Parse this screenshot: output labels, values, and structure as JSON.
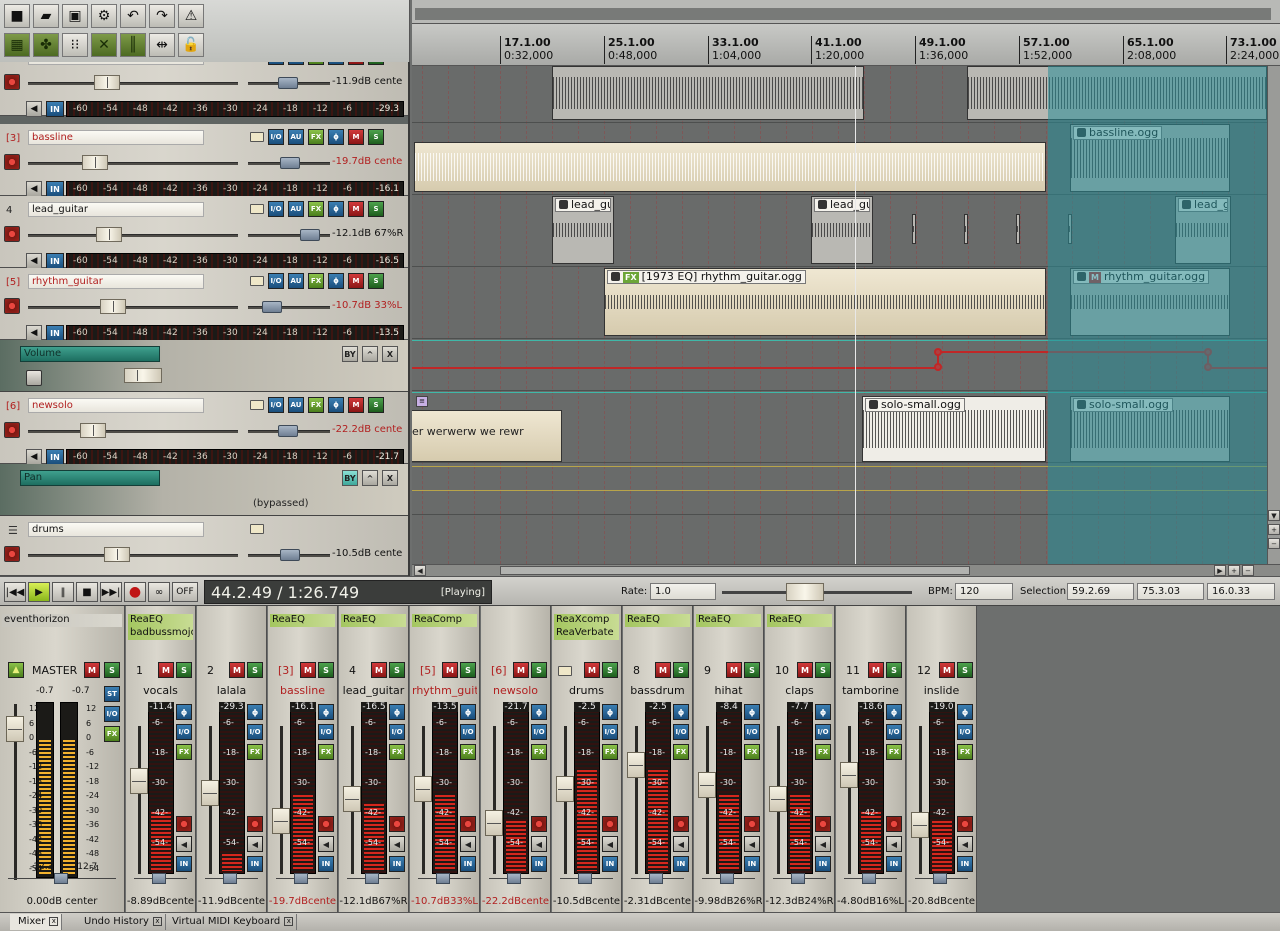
{
  "ruler": [
    {
      "bar": "17.1.00",
      "time": "0:32,000"
    },
    {
      "bar": "25.1.00",
      "time": "0:48,000"
    },
    {
      "bar": "33.1.00",
      "time": "1:04,000"
    },
    {
      "bar": "41.1.00",
      "time": "1:20,000"
    },
    {
      "bar": "49.1.00",
      "time": "1:36,000"
    },
    {
      "bar": "57.1.00",
      "time": "1:52,000"
    },
    {
      "bar": "65.1.00",
      "time": "2:08,000"
    },
    {
      "bar": "73.1.00",
      "time": "2:24,000"
    }
  ],
  "tracks": [
    {
      "num": "2",
      "name": "lalala",
      "vol": "-11.9dB cente",
      "peak": "-29.3",
      "highlight": false
    },
    {
      "num": "[3]",
      "name": "bassline",
      "vol": "-19.7dB cente",
      "peak": "-16.1",
      "highlight": true
    },
    {
      "num": "4",
      "name": "lead_guitar",
      "vol": "-12.1dB 67%R",
      "peak": "-16.5",
      "highlight": false
    },
    {
      "num": "[5]",
      "name": "rhythm_guitar",
      "vol": "-10.7dB 33%L",
      "peak": "-13.5",
      "highlight": true
    },
    {
      "num": "[6]",
      "name": "newsolo",
      "vol": "-22.2dB cente",
      "peak": "-21.7",
      "highlight": true
    },
    {
      "num": "",
      "name": "drums",
      "vol": "-10.5dB cente",
      "peak": "",
      "highlight": false
    }
  ],
  "track_buttons": {
    "phase": "ϕ",
    "mute": "M",
    "solo": "S",
    "au": "AU",
    "fx": "FX",
    "io": "I/O",
    "in": "IN"
  },
  "meter_scale": [
    "-60",
    "-54",
    "-48",
    "-42",
    "-36",
    "-30",
    "-24",
    "-18",
    "-12",
    "-6"
  ],
  "envelopes": {
    "volume": {
      "name": "Volume"
    },
    "pan": {
      "name": "Pan",
      "status": "(bypassed)"
    },
    "buttons": {
      "bypass": "BY",
      "arm": "^",
      "close": "X"
    }
  },
  "items": {
    "bassline": "bassline.ogg",
    "lead1": "lead_gu",
    "lead2": "lead_gu",
    "lead3": "lead_g",
    "rhythm1": "[1973 EQ] rhythm_guitar.ogg",
    "rhythm2": "rhythm_guitar.ogg",
    "solo1": "solo-small.ogg",
    "solo2": "solo-small.ogg",
    "text": "wer werwerw we rewr",
    "fx_tag": "FX",
    "m_tag": "M"
  },
  "transport": {
    "time": "44.2.49 / 1:26.749",
    "status": "[Playing]",
    "off": "OFF",
    "rate_label": "Rate:",
    "rate": "1.0",
    "bpm_label": "BPM:",
    "bpm": "120",
    "selection_label": "Selection",
    "sel_start": "59.2.69",
    "sel_end": "75.3.03",
    "sel_len": "16.0.33"
  },
  "master": {
    "theme_name": "eventhorizon",
    "label": "MASTER",
    "peak_l": "-0.7",
    "peak_r": "-0.7",
    "bottom_l": "-12.3",
    "bottom_r": "-12.7",
    "volume": "0.00dB center",
    "st": "ST",
    "scale": [
      "12",
      "6",
      "0",
      "-6",
      "-12",
      "-18",
      "-24",
      "-30",
      "-36",
      "-42",
      "-48",
      "-54"
    ]
  },
  "strips": [
    {
      "num": "1",
      "name": "vocals",
      "fx1": "ReaEQ",
      "fx2": "badbussmojo",
      "peak": "-11.4",
      "vol": "-8.89dBcente",
      "hl": false,
      "level": 0.35,
      "fader": 0.35
    },
    {
      "num": "2",
      "name": "lalala",
      "fx1": "",
      "fx2": "",
      "peak": "-29.3",
      "vol": "-11.9dBcente",
      "hl": false,
      "level": 0.1,
      "fader": 0.45
    },
    {
      "num": "[3]",
      "name": "bassline",
      "fx1": "ReaEQ",
      "fx2": "",
      "peak": "-16.1",
      "vol": "-19.7dBcente",
      "hl": true,
      "level": 0.45,
      "fader": 0.68
    },
    {
      "num": "4",
      "name": "lead_guitar",
      "fx1": "ReaEQ",
      "fx2": "",
      "peak": "-16.5",
      "vol": "-12.1dB67%R",
      "hl": false,
      "level": 0.4,
      "fader": 0.5
    },
    {
      "num": "[5]",
      "name": "rhythm_guit",
      "fx1": "ReaComp",
      "fx2": "",
      "peak": "-13.5",
      "vol": "-10.7dB33%L",
      "hl": true,
      "level": 0.45,
      "fader": 0.42
    },
    {
      "num": "[6]",
      "name": "newsolo",
      "fx1": "",
      "fx2": "",
      "peak": "-21.7",
      "vol": "-22.2dBcente",
      "hl": true,
      "level": 0.3,
      "fader": 0.7
    },
    {
      "num": "",
      "name": "drums",
      "fx1": "ReaXcomp",
      "fx2": "ReaVerbate",
      "peak": "-2.5",
      "vol": "-10.5dBcente",
      "hl": false,
      "level": 0.6,
      "fader": 0.42
    },
    {
      "num": "8",
      "name": "bassdrum",
      "fx1": "ReaEQ",
      "fx2": "",
      "peak": "-2.5",
      "vol": "-2.31dBcente",
      "hl": false,
      "level": 0.6,
      "fader": 0.22
    },
    {
      "num": "9",
      "name": "hihat",
      "fx1": "ReaEQ",
      "fx2": "",
      "peak": "-8.4",
      "vol": "-9.98dB26%R",
      "hl": false,
      "level": 0.45,
      "fader": 0.38
    },
    {
      "num": "10",
      "name": "claps",
      "fx1": "ReaEQ",
      "fx2": "",
      "peak": "-7.7",
      "vol": "-12.3dB24%R",
      "hl": false,
      "level": 0.45,
      "fader": 0.5
    },
    {
      "num": "11",
      "name": "tamborine",
      "fx1": "",
      "fx2": "",
      "peak": "-18.6",
      "vol": "-4.80dB16%L",
      "hl": false,
      "level": 0.35,
      "fader": 0.3
    },
    {
      "num": "12",
      "name": "inslide",
      "fx1": "",
      "fx2": "",
      "peak": "-19.0",
      "vol": "-20.8dBcente",
      "hl": false,
      "level": 0.3,
      "fader": 0.72
    }
  ],
  "strip_scale": [
    "-6-",
    "-18-",
    "-30-",
    "-42-",
    "-54-"
  ],
  "tabs": [
    "Mixer",
    "Undo History",
    "Virtual MIDI Keyboard"
  ]
}
